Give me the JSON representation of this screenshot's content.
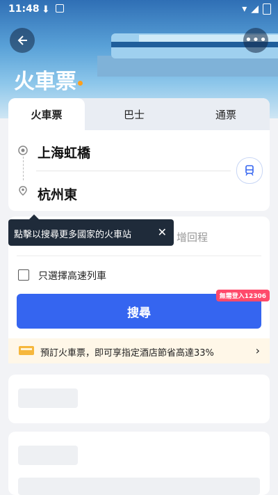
{
  "status_bar": {
    "time": "11:48",
    "icons_left": [
      "download-icon",
      "app-a-icon"
    ],
    "icons_right": [
      "wifi-icon",
      "signal-icon",
      "battery-icon"
    ]
  },
  "header": {
    "title": "火車票",
    "back_icon": "back-arrow-icon",
    "more_icon": "more-icon"
  },
  "tabs": [
    {
      "label": "火車票",
      "active": true
    },
    {
      "label": "巴士",
      "active": false
    },
    {
      "label": "通票",
      "active": false
    }
  ],
  "route": {
    "from": "上海虹橋",
    "to": "杭州東",
    "swap_icon": "train-swap-icon"
  },
  "tooltip": {
    "text": "點擊以搜尋更多國家的火車站",
    "close": "✕"
  },
  "return_text": "增回程",
  "options": {
    "high_speed_label": "只選擇高速列車",
    "high_speed_checked": false
  },
  "search": {
    "label": "搜尋",
    "badge": "無需登入12306"
  },
  "promo": {
    "text": "預訂火車票，即可享指定酒店節省高達33%",
    "chevron": "›"
  },
  "colors": {
    "accent": "#3565f0",
    "badge": "#ff4a6b",
    "tooltip": "#1f2b3a"
  }
}
